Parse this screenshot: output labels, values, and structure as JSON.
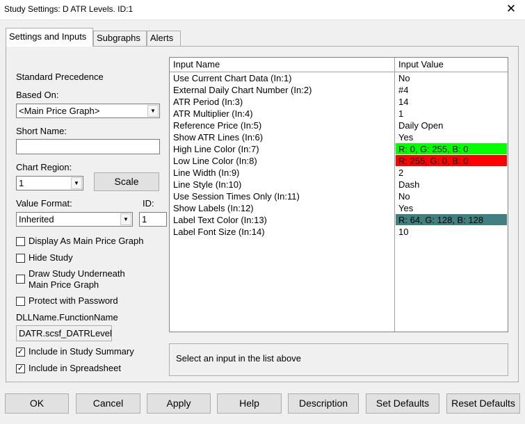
{
  "window": {
    "title": "Study Settings: D ATR Levels. ID:1",
    "close_glyph": "✕"
  },
  "tabs": [
    {
      "label": "Settings and Inputs"
    },
    {
      "label": "Subgraphs"
    },
    {
      "label": "Alerts"
    }
  ],
  "left": {
    "standard_precedence": "Standard Precedence",
    "based_on_label": "Based On:",
    "based_on_value": "<Main Price Graph>",
    "short_name_label": "Short Name:",
    "short_name_value": "",
    "chart_region_label": "Chart Region:",
    "chart_region_value": "1",
    "scale_button": "Scale",
    "value_format_label": "Value Format:",
    "value_format_value": "Inherited",
    "id_label": "ID:",
    "id_value": "1",
    "display_as_main": "Display As Main Price Graph",
    "hide_study": "Hide Study",
    "draw_underneath_1": "Draw Study Underneath",
    "draw_underneath_2": "Main Price Graph",
    "protect_password": "Protect with Password",
    "dll_label": "DLLName.FunctionName",
    "dll_value": "DATR.scsf_DATRLevels",
    "include_summary": "Include in Study Summary",
    "include_spreadsheet": "Include in Spreadsheet",
    "check_glyph": "✓"
  },
  "grid": {
    "col_name": "Input Name",
    "col_value": "Input Value",
    "rows": [
      {
        "name": "Use Current Chart Data  (In:1)",
        "value": "No"
      },
      {
        "name": "External Daily Chart Number  (In:2)",
        "value": "#4"
      },
      {
        "name": "ATR Period  (In:3)",
        "value": "14"
      },
      {
        "name": "ATR Multiplier  (In:4)",
        "value": "1"
      },
      {
        "name": "Reference Price  (In:5)",
        "value": "Daily Open"
      },
      {
        "name": "Show ATR Lines  (In:6)",
        "value": "Yes"
      },
      {
        "name": "High Line Color  (In:7)",
        "value": "R: 0, G: 255, B: 0",
        "color": "#00ff00"
      },
      {
        "name": "Low Line Color  (In:8)",
        "value": "R: 255, G: 0, B: 0",
        "color": "#ff0000"
      },
      {
        "name": "Line Width  (In:9)",
        "value": "2"
      },
      {
        "name": "Line Style  (In:10)",
        "value": "Dash"
      },
      {
        "name": "Use Session Times Only  (In:11)",
        "value": "No"
      },
      {
        "name": "Show Labels  (In:12)",
        "value": "Yes"
      },
      {
        "name": "Label Text Color  (In:13)",
        "value": "R: 64, G: 128, B: 128",
        "color": "#408080"
      },
      {
        "name": "Label Font Size  (In:14)",
        "value": "10"
      }
    ]
  },
  "description": "Select an input in the list above",
  "buttons": {
    "ok": "OK",
    "cancel": "Cancel",
    "apply": "Apply",
    "help": "Help",
    "description": "Description",
    "set_defaults": "Set Defaults",
    "reset_defaults": "Reset Defaults"
  }
}
